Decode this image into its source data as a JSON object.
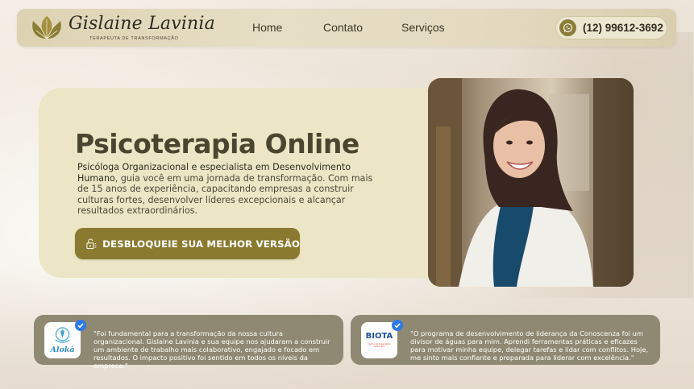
{
  "brand": {
    "name": "Gislaine Lavinia",
    "tagline": "TERAPEUTA DE TRANSFORMAÇÃO",
    "logo_icon": "lotus-leaf-icon",
    "accent_color": "#8a7a30"
  },
  "nav": {
    "items": [
      "Home",
      "Contato",
      "Serviços"
    ],
    "phone": "(12) 99612-3692",
    "phone_icon": "whatsapp-icon"
  },
  "hero": {
    "title": "Psicoterapia Online",
    "desc_lead": "Psicóloga Organizacional e especialista em Desenvolvimento Humano",
    "desc_rest": ", guia você em uma jornada de transformação. Com mais de 15 anos de experiência, capacitando empresas a construir culturas fortes, desenvolver líderes excepcionais e alcançar resultados extraordinários.",
    "cta_label": "DESBLOQUEIE SUA MELHOR VERSÃO",
    "cta_icon": "unlock-icon",
    "photo": "portrait-photo"
  },
  "testimonials": [
    {
      "logo_text": "Aloká",
      "quote": "\"Foi fundamental para a transformação da nossa cultura organizacional. Gislaine Lavinia e sua equipe nos ajudaram a construir um ambiente de trabalho mais colaborativo, engajado e focado em resultados. O impacto positivo foi sentido em todos os níveis da empresa.\""
    },
    {
      "logo_text": "BIOTA",
      "logo_subtext": "Centro de Diagnóstico Veterinário",
      "quote": "\"O programa de desenvolvimento de liderança da Conoscenza foi um divisor de águas para mim. Aprendi ferramentas práticas e eficazes para motivar minha equipe, delegar tarefas e lidar com conflitos. Hoje, me sinto mais confiante e preparada para liderar com excelência.\""
    }
  ]
}
